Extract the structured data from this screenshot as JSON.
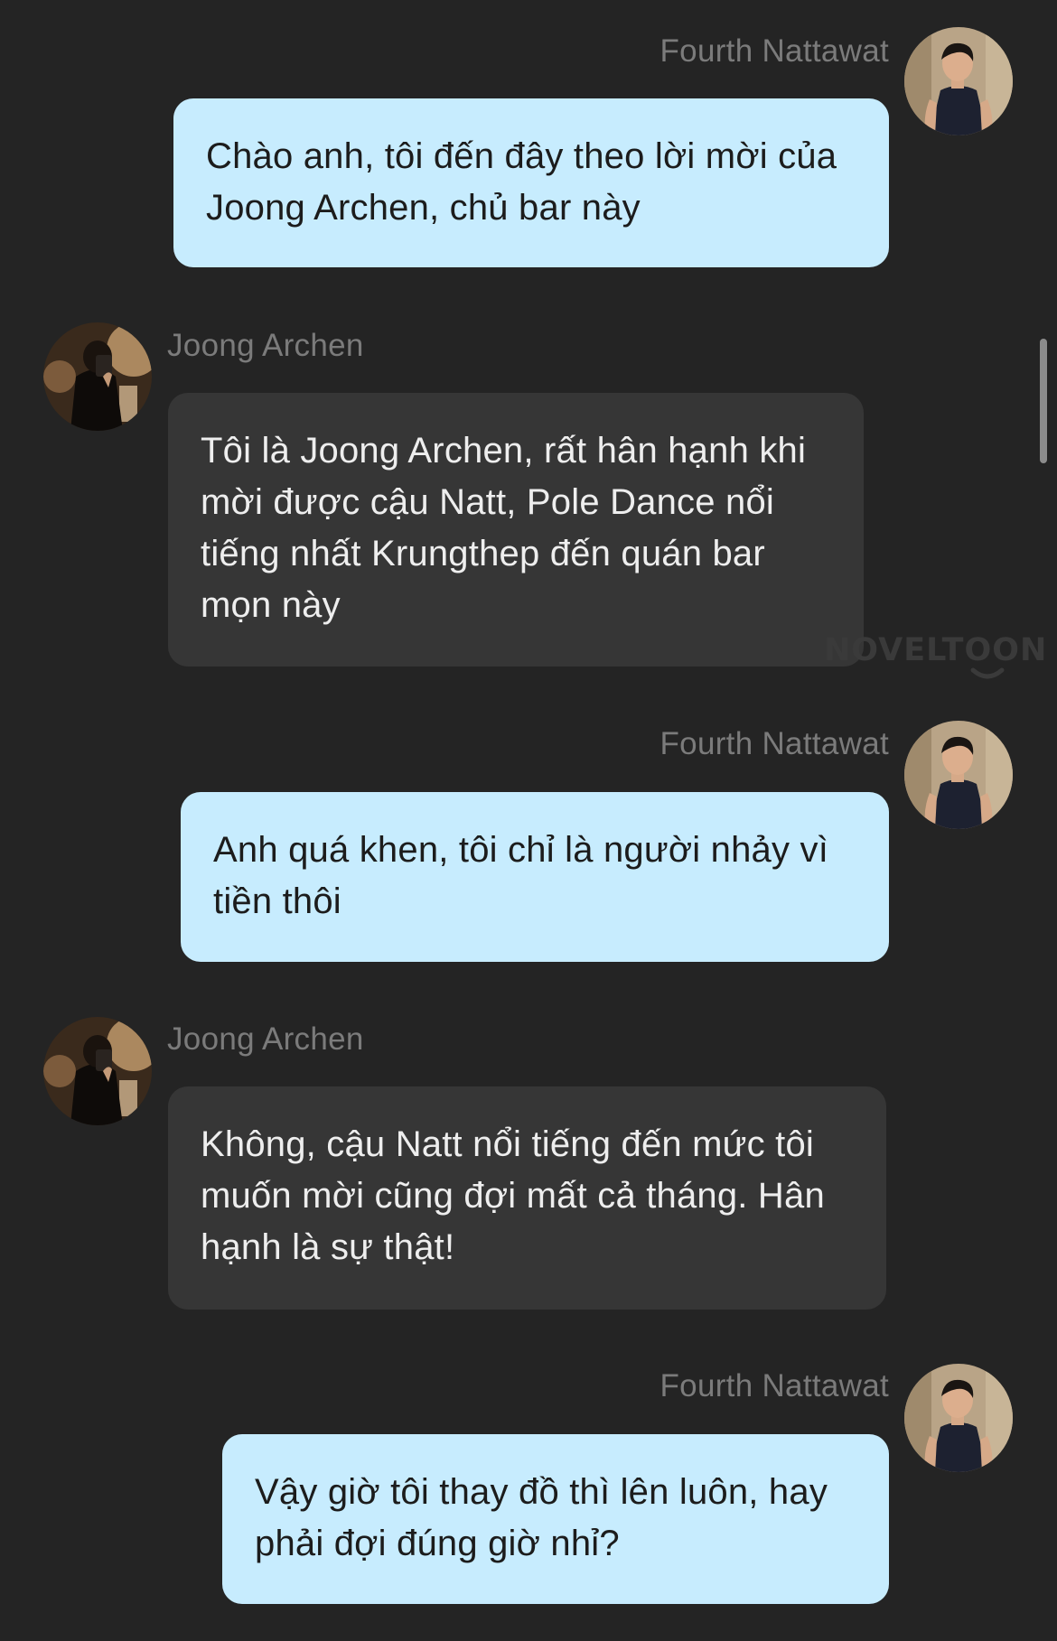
{
  "participants": {
    "fourth": {
      "name": "Fourth Nattawat",
      "avatar_icon": "person-avatar-icon"
    },
    "joong": {
      "name": "Joong Archen",
      "avatar_icon": "person-avatar-icon"
    }
  },
  "messages": [
    {
      "sender": "Fourth Nattawat",
      "side": "right",
      "text": "Chào anh, tôi đến đây theo lời mời của Joong Archen, chủ bar này"
    },
    {
      "sender": "Joong Archen",
      "side": "left",
      "text": "Tôi là Joong Archen, rất hân hạnh khi mời được cậu Natt, Pole Dance nổi tiếng nhất Krungthep đến quán bar mọn này"
    },
    {
      "sender": "Fourth Nattawat",
      "side": "right",
      "text": "Anh quá khen, tôi chỉ là người nhảy vì tiền thôi"
    },
    {
      "sender": "Joong Archen",
      "side": "left",
      "text": "Không, cậu Natt nổi tiếng đến mức tôi muốn mời cũng đợi mất cả tháng. Hân hạnh là sự thật!"
    },
    {
      "sender": "Fourth Nattawat",
      "side": "right",
      "text": "Vậy giờ tôi thay đồ thì lên luôn, hay phải đợi đúng giờ nhỉ?"
    }
  ],
  "watermark": {
    "text": "NOVELTOON"
  },
  "colors": {
    "background": "#242424",
    "outgoing_bubble": "#c7ecfe",
    "incoming_bubble": "#363636",
    "name_text": "#7b7b7b"
  }
}
